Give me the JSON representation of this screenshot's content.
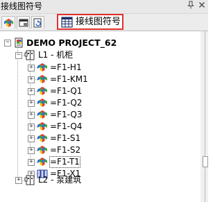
{
  "window": {
    "title": "接线图符号",
    "pin_icon": "pin-icon",
    "close_icon": "close-icon"
  },
  "tabs": {
    "active_label": "接线图符号",
    "icons": [
      "color-cubes-icon",
      "page-icon",
      "refresh-page-icon",
      "grid-table-icon"
    ]
  },
  "tree": {
    "root_label": "DEMO PROJECT_62",
    "l1_label": "L1 - 机柜",
    "l2_label": "L2 - 泵建筑",
    "items": [
      "=F1-H1",
      "=F1-KM1",
      "=F1-Q1",
      "=F1-Q2",
      "=F1-Q3",
      "=F1-Q4",
      "=F1-S1",
      "=F1-S2",
      "=F1-T1",
      "=F1-X1"
    ],
    "selected_item": "=F1-T1"
  },
  "colors": {
    "active_tab_border": "#e0312b",
    "cube_red": "#e53a2f",
    "cube_green": "#3aa63a",
    "cube_blue": "#2f6fd6",
    "cube_yellow": "#f2c21a"
  }
}
